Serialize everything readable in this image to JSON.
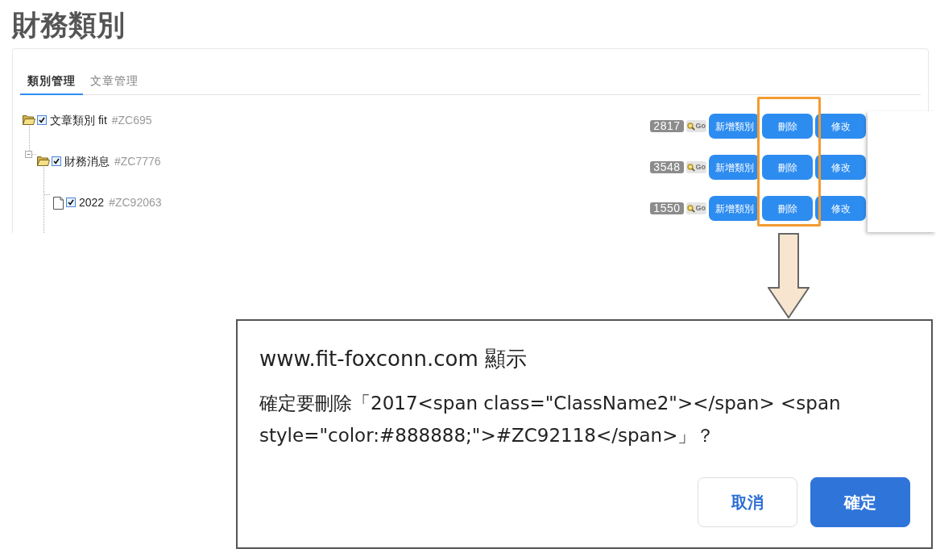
{
  "page": {
    "title": "財務類別"
  },
  "tabs": [
    {
      "label": "類別管理",
      "selected": true
    },
    {
      "label": "文章管理",
      "selected": false
    }
  ],
  "tree": [
    {
      "kind": "folder",
      "name": "文章類別 fit",
      "code": "#ZC695",
      "checked": true,
      "count": "2817",
      "go": "Go",
      "buttons": [
        "新增類別",
        "刪除",
        "修改"
      ],
      "children": [
        {
          "kind": "folder",
          "expanded": true,
          "name": "財務消息",
          "code": "#ZC7776",
          "checked": true,
          "count": "3548",
          "go": "Go",
          "buttons": [
            "新增類別",
            "刪除",
            "修改"
          ],
          "children": [
            {
              "kind": "file",
              "name": "2022",
              "code": "#ZC92063",
              "checked": true,
              "count": "1550",
              "go": "Go",
              "buttons": [
                "新增類別",
                "刪除",
                "修改"
              ]
            }
          ]
        }
      ]
    }
  ],
  "dialog": {
    "title": "www.fit-foxconn.com 顯示",
    "message": "確定要刪除「2017<span class=\"ClassName2\"></span> <span style=\"color:#888888;\">#ZC92118</span>」？",
    "buttons": [
      {
        "label": "取消",
        "kind": "secondary"
      },
      {
        "label": "確定",
        "kind": "primary"
      }
    ]
  }
}
